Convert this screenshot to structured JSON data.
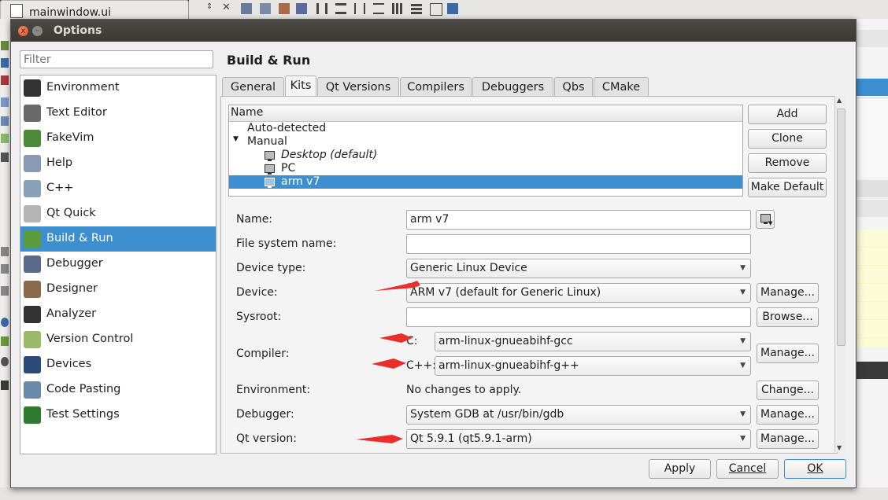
{
  "background": {
    "file_tab": "mainwindow.ui"
  },
  "window": {
    "title": "Options",
    "close_glyph": "x",
    "min_glyph": "–"
  },
  "filter": {
    "placeholder": "Filter"
  },
  "nav": {
    "selected_index": 8,
    "items": [
      {
        "label": "Environment",
        "icon": "environment-icon",
        "color": "#333333"
      },
      {
        "label": "Text Editor",
        "icon": "text-editor-icon",
        "color": "#6a6a6a"
      },
      {
        "label": "FakeVim",
        "icon": "fakevim-icon",
        "color": "#4f8a3a"
      },
      {
        "label": "Help",
        "icon": "help-icon",
        "color": "#8a9ab5"
      },
      {
        "label": "C++",
        "icon": "cpp-icon",
        "color": "#8aa0b8"
      },
      {
        "label": "Qt Quick",
        "icon": "qt-quick-icon",
        "color": "#b5b5b5"
      },
      {
        "label": "Build & Run",
        "icon": "build-run-icon",
        "color": "#5a9a3a"
      },
      {
        "label": "Debugger",
        "icon": "debugger-icon",
        "color": "#5a6a8a"
      },
      {
        "label": "Designer",
        "icon": "designer-icon",
        "color": "#8a6a4a"
      },
      {
        "label": "Analyzer",
        "icon": "analyzer-icon",
        "color": "#333333"
      },
      {
        "label": "Version Control",
        "icon": "version-control-icon",
        "color": "#9aba6a"
      },
      {
        "label": "Devices",
        "icon": "devices-icon",
        "color": "#2a4a7a"
      },
      {
        "label": "Code Pasting",
        "icon": "code-pasting-icon",
        "color": "#6a8aaa"
      },
      {
        "label": "Test Settings",
        "icon": "test-settings-icon",
        "color": "#2f7a2f"
      }
    ]
  },
  "page": {
    "title": "Build & Run",
    "tabs": [
      "General",
      "Kits",
      "Qt Versions",
      "Compilers",
      "Debuggers",
      "Qbs",
      "CMake"
    ],
    "active_tab": "Kits"
  },
  "kits_tree": {
    "header": "Name",
    "auto_detected": "Auto-detected",
    "manual": "Manual",
    "kits": [
      "Desktop (default)",
      "PC",
      "arm v7"
    ],
    "selected_kit": "arm v7"
  },
  "kit_buttons": {
    "add": "Add",
    "clone": "Clone",
    "remove": "Remove",
    "make_default": "Make Default"
  },
  "form": {
    "name_label": "Name:",
    "name_value": "arm v7",
    "file_system_name_label": "File system name:",
    "file_system_name_value": "",
    "device_type_label": "Device type:",
    "device_type_value": "Generic Linux Device",
    "device_label": "Device:",
    "device_value": "ARM v7 (default for Generic Linux)",
    "device_manage": "Manage...",
    "sysroot_label": "Sysroot:",
    "sysroot_value": "",
    "sysroot_browse": "Browse...",
    "compiler_label": "Compiler:",
    "compiler_c_label": "C:",
    "compiler_c_value": "arm-linux-gnueabihf-gcc",
    "compiler_cpp_label": "C++:",
    "compiler_cpp_value": "arm-linux-gnueabihf-g++",
    "compiler_manage": "Manage...",
    "environment_label": "Environment:",
    "environment_value": "No changes to apply.",
    "environment_change": "Change...",
    "debugger_label": "Debugger:",
    "debugger_value": "System GDB at /usr/bin/gdb",
    "debugger_manage": "Manage...",
    "qt_version_label": "Qt version:",
    "qt_version_value": "Qt 5.9.1 (qt5.9.1-arm)",
    "qt_version_manage": "Manage..."
  },
  "dialog_buttons": {
    "apply": "Apply",
    "cancel": "Cancel",
    "ok": "OK"
  },
  "annotation_color": "#e8302a"
}
